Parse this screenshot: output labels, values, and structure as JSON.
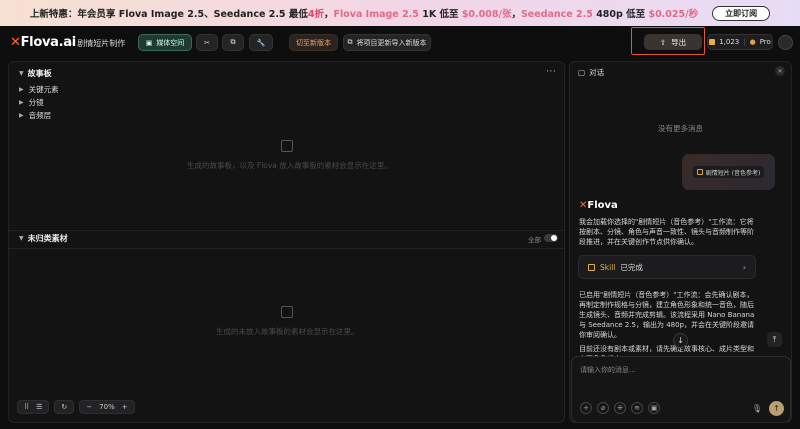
{
  "banner": {
    "part1": "上新特惠：年会员享 Flova Image 2.5、Seedance 2.5 最低",
    "discount": "4折",
    "part2": "，",
    "product1": "Flova Image 2.5",
    "part3": " 1K 低至 ",
    "price1": "$0.008/张",
    "part4": "，",
    "product2": "Seedance 2.5",
    "part5": " 480p 低至 ",
    "price2": "$0.025/秒",
    "cta": "立即订阅"
  },
  "topbar": {
    "logo": "Flova.ai",
    "breadcrumb_sep": "›",
    "project_name": "剧情短片制作",
    "media_space": "媒体空间",
    "switch_version": "切至新版本",
    "update_project": "将项目更新导入新版本",
    "export": "导出",
    "credits": "1,023",
    "plan": "Pro"
  },
  "storyboard": {
    "title": "故事板",
    "items": [
      {
        "label": "关键元素"
      },
      {
        "label": "分镜"
      },
      {
        "label": "音频层"
      }
    ],
    "empty_text": "生成的故事板，以及 Flova 放入故事板的素材会显示在这里。"
  },
  "unsorted": {
    "title": "未归类素材",
    "toggle_label": "全部",
    "empty_text": "生成的未放入故事板的素材会显示在这里。"
  },
  "bottom_toolbar": {
    "zoom": "70%",
    "zoom_minus": "−",
    "zoom_plus": "+"
  },
  "chat": {
    "title": "对话",
    "no_more": "没有更多消息",
    "user_chip": "剧情短片 (音色参考)",
    "ai_logo": "Flova",
    "ai_msg1": "我会加载你选择的\"剧情短片（音色参考）\"工作流：它将按剧本、分镜、角色与声音一致性、镜头与音频制作等阶段推进，并在关键创作节点供你确认。",
    "skill_label": "Skill",
    "skill_status": "已完成",
    "ai_msg2": "已启用\"剧情短片（音色参考）\"工作流：会先确认剧本，再制定制作规格与分镜，建立角色形象和统一音色，随后生成镜头、音频并完成剪辑。该流程采用 Nano Banana 与 Seedance 2.5，输出为 480p，并会在关键阶段邀请你审阅确认。",
    "ai_msg3": "目前还没有剧本或素材，请先确定故事核心、成片类型和主要角色设定。",
    "input_placeholder": "请输入你的消息..."
  },
  "colors": {
    "accent_orange": "#ff6b2c",
    "export_highlight": "#e2563f",
    "skill_gold": "#e0b040"
  }
}
